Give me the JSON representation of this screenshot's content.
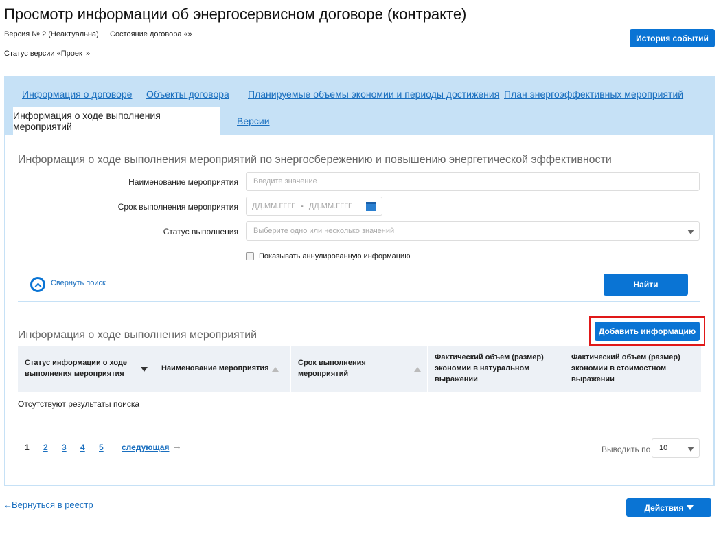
{
  "header": {
    "title": "Просмотр информации об энергосервисном договоре (контракте)",
    "version": "Версия № 2 (Неактуальна)",
    "contract_state": "Состояние договора «»",
    "version_status": "Статус версии «Проект»",
    "history_button": "История событий"
  },
  "tabs": [
    {
      "label": "Информация о договоре"
    },
    {
      "label": "Объекты договора"
    },
    {
      "label": "Планируемые объемы экономии и периоды достижения"
    },
    {
      "label": "План энергоэффективных мероприятий"
    },
    {
      "label": "Информация о ходе выполнения мероприятий",
      "active": true
    },
    {
      "label": "Версии"
    }
  ],
  "search": {
    "title": "Информация о ходе выполнения мероприятий по энергосбережению и повышению энергетической эффективности",
    "name_label": "Наименование мероприятия",
    "name_placeholder": "Введите значение",
    "date_label": "Срок выполнения мероприятия",
    "date_from": "ДД.ММ.ГГГГ",
    "date_sep": "-",
    "date_to": "ДД.ММ.ГГГГ",
    "status_label": "Статус выполнения",
    "status_placeholder": "Выберите одно или несколько значений",
    "show_cancelled": "Показывать аннулированную информацию",
    "collapse": "Свернуть поиск",
    "find_button": "Найти"
  },
  "results": {
    "title": "Информация о ходе выполнения мероприятий",
    "add_button": "Добавить информацию",
    "columns": [
      "Статус информации о ходе выполнения мероприятия",
      "Наименование мероприятия",
      "Срок выполнения мероприятий",
      "Фактический объем (размер) экономии в натуральном выражении",
      "Фактический объем (размер) экономии в стоимостном выражении"
    ],
    "empty": "Отсутствуют результаты поиска"
  },
  "pagination": {
    "pages": [
      "1",
      "2",
      "3",
      "4",
      "5"
    ],
    "next": "следующая",
    "per_page_label": "Выводить по",
    "per_page": "10"
  },
  "footer": {
    "back": "Вернуться в реестр",
    "actions": "Действия"
  }
}
